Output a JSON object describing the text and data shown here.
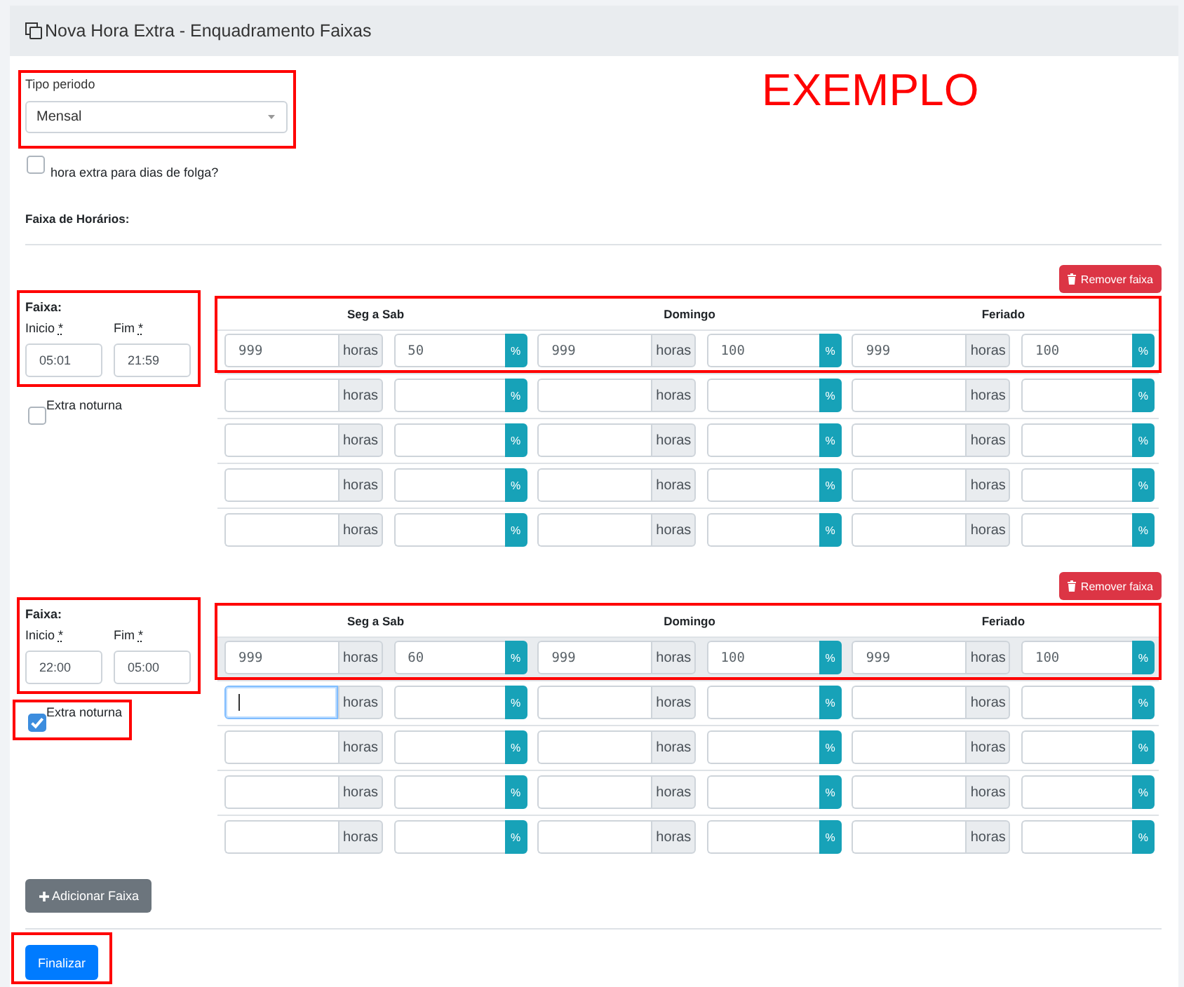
{
  "header": {
    "title": "Nova Hora Extra - Enquadramento Faixas"
  },
  "period": {
    "label": "Tipo periodo",
    "value": "Mensal",
    "framed": true
  },
  "annotation": {
    "text": "EXEMPLO"
  },
  "day_off_checkbox": {
    "label": "hora extra para dias de folga?",
    "checked": false
  },
  "section_title": "Faixa de Horários:",
  "faixas": [
    {
      "remove_button": "Remover faixa",
      "title": "Faixa:",
      "framed": true,
      "start": {
        "label": "Inicio",
        "required_mark": "*",
        "value": "05:01"
      },
      "end": {
        "label": "Fim",
        "required_mark": "*",
        "value": "21:59"
      },
      "night_checkbox": {
        "label": "Extra noturna",
        "checked": false,
        "framed": false
      },
      "table": {
        "framed": true,
        "columns": [
          "Seg a Sab",
          "Domingo",
          "Feriado"
        ],
        "rows": [
          {
            "shaded": false,
            "cells": [
              {
                "hours": {
                  "value": "999",
                  "unit": "horas",
                  "focused": false
                },
                "percent": {
                  "value": "50",
                  "unit": "%",
                  "focused": false
                }
              },
              {
                "hours": {
                  "value": "999",
                  "unit": "horas",
                  "focused": false
                },
                "percent": {
                  "value": "100",
                  "unit": "%",
                  "focused": false
                }
              },
              {
                "hours": {
                  "value": "999",
                  "unit": "horas",
                  "focused": false
                },
                "percent": {
                  "value": "100",
                  "unit": "%",
                  "focused": false
                }
              }
            ]
          },
          {
            "shaded": false,
            "cells": [
              {
                "hours": {
                  "unit": "horas",
                  "focused": false
                },
                "percent": {
                  "unit": "%",
                  "focused": false
                }
              },
              {
                "hours": {
                  "unit": "horas",
                  "focused": false
                },
                "percent": {
                  "unit": "%",
                  "focused": false
                }
              },
              {
                "hours": {
                  "unit": "horas",
                  "focused": false
                },
                "percent": {
                  "unit": "%",
                  "focused": false
                }
              }
            ]
          },
          {
            "shaded": false,
            "cells": [
              {
                "hours": {
                  "unit": "horas",
                  "focused": false
                },
                "percent": {
                  "unit": "%",
                  "focused": false
                }
              },
              {
                "hours": {
                  "unit": "horas",
                  "focused": false
                },
                "percent": {
                  "unit": "%",
                  "focused": false
                }
              },
              {
                "hours": {
                  "unit": "horas",
                  "focused": false
                },
                "percent": {
                  "unit": "%",
                  "focused": false
                }
              }
            ]
          },
          {
            "shaded": false,
            "cells": [
              {
                "hours": {
                  "unit": "horas",
                  "focused": false
                },
                "percent": {
                  "unit": "%",
                  "focused": false
                }
              },
              {
                "hours": {
                  "unit": "horas",
                  "focused": false
                },
                "percent": {
                  "unit": "%",
                  "focused": false
                }
              },
              {
                "hours": {
                  "unit": "horas",
                  "focused": false
                },
                "percent": {
                  "unit": "%",
                  "focused": false
                }
              }
            ]
          },
          {
            "shaded": false,
            "cells": [
              {
                "hours": {
                  "unit": "horas",
                  "focused": false
                },
                "percent": {
                  "unit": "%",
                  "focused": false
                }
              },
              {
                "hours": {
                  "unit": "horas",
                  "focused": false
                },
                "percent": {
                  "unit": "%",
                  "focused": false
                }
              },
              {
                "hours": {
                  "unit": "horas",
                  "focused": false
                },
                "percent": {
                  "unit": "%",
                  "focused": false
                }
              }
            ]
          }
        ]
      }
    },
    {
      "remove_button": "Remover faixa",
      "title": "Faixa:",
      "framed": true,
      "start": {
        "label": "Inicio",
        "required_mark": "*",
        "value": "22:00"
      },
      "end": {
        "label": "Fim",
        "required_mark": "*",
        "value": "05:00"
      },
      "night_checkbox": {
        "label": "Extra noturna",
        "checked": true,
        "framed": true
      },
      "table": {
        "framed": true,
        "columns": [
          "Seg a Sab",
          "Domingo",
          "Feriado"
        ],
        "rows": [
          {
            "shaded": true,
            "cells": [
              {
                "hours": {
                  "value": "999",
                  "unit": "horas",
                  "focused": false
                },
                "percent": {
                  "value": "60",
                  "unit": "%",
                  "focused": false
                }
              },
              {
                "hours": {
                  "value": "999",
                  "unit": "horas",
                  "focused": false
                },
                "percent": {
                  "value": "100",
                  "unit": "%",
                  "focused": false
                }
              },
              {
                "hours": {
                  "value": "999",
                  "unit": "horas",
                  "focused": false
                },
                "percent": {
                  "value": "100",
                  "unit": "%",
                  "focused": false
                }
              }
            ]
          },
          {
            "shaded": false,
            "cells": [
              {
                "hours": {
                  "unit": "horas",
                  "focused": true
                },
                "percent": {
                  "unit": "%",
                  "focused": false
                }
              },
              {
                "hours": {
                  "unit": "horas",
                  "focused": false
                },
                "percent": {
                  "unit": "%",
                  "focused": false
                }
              },
              {
                "hours": {
                  "unit": "horas",
                  "focused": false
                },
                "percent": {
                  "unit": "%",
                  "focused": false
                }
              }
            ]
          },
          {
            "shaded": false,
            "cells": [
              {
                "hours": {
                  "unit": "horas",
                  "focused": false
                },
                "percent": {
                  "unit": "%",
                  "focused": false
                }
              },
              {
                "hours": {
                  "unit": "horas",
                  "focused": false
                },
                "percent": {
                  "unit": "%",
                  "focused": false
                }
              },
              {
                "hours": {
                  "unit": "horas",
                  "focused": false
                },
                "percent": {
                  "unit": "%",
                  "focused": false
                }
              }
            ]
          },
          {
            "shaded": false,
            "cells": [
              {
                "hours": {
                  "unit": "horas",
                  "focused": false
                },
                "percent": {
                  "unit": "%",
                  "focused": false
                }
              },
              {
                "hours": {
                  "unit": "horas",
                  "focused": false
                },
                "percent": {
                  "unit": "%",
                  "focused": false
                }
              },
              {
                "hours": {
                  "unit": "horas",
                  "focused": false
                },
                "percent": {
                  "unit": "%",
                  "focused": false
                }
              }
            ]
          },
          {
            "shaded": false,
            "cells": [
              {
                "hours": {
                  "unit": "horas",
                  "focused": false
                },
                "percent": {
                  "unit": "%",
                  "focused": false
                }
              },
              {
                "hours": {
                  "unit": "horas",
                  "focused": false
                },
                "percent": {
                  "unit": "%",
                  "focused": false
                }
              },
              {
                "hours": {
                  "unit": "horas",
                  "focused": false
                },
                "percent": {
                  "unit": "%",
                  "focused": false
                }
              }
            ]
          }
        ]
      }
    }
  ],
  "add_button": "Adicionar Faixa",
  "finish": {
    "label": "Finalizar",
    "framed": true
  }
}
